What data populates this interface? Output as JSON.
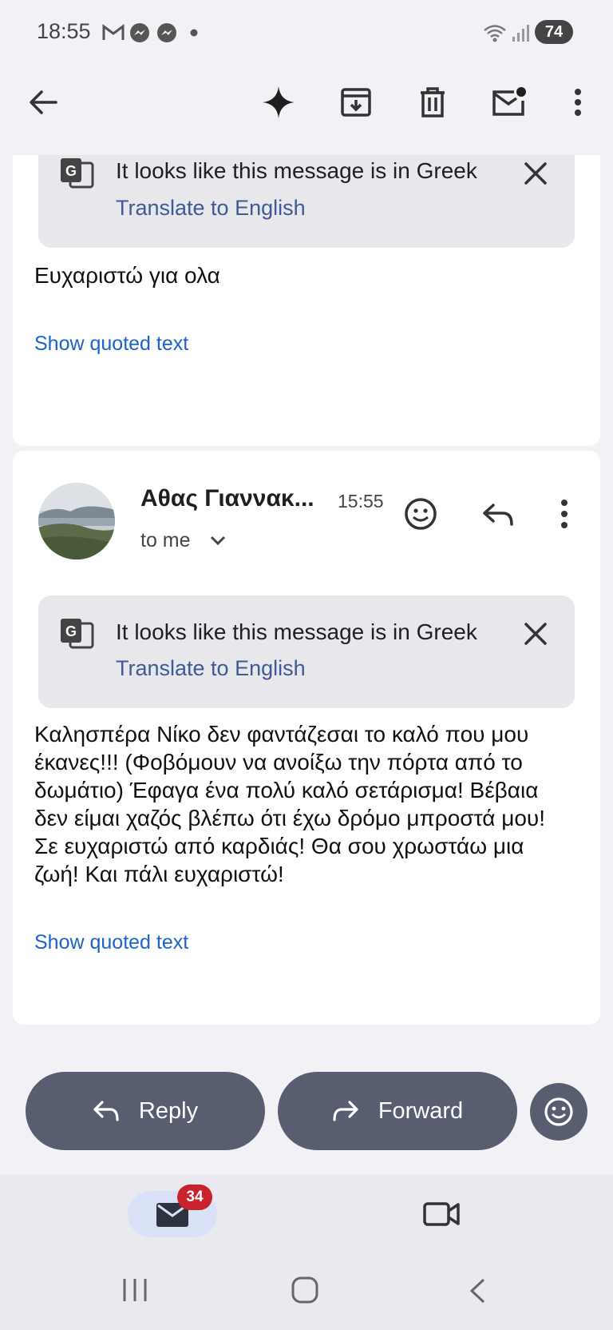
{
  "status_bar": {
    "time": "18:55",
    "battery": "74"
  },
  "toolbar": {
    "back": "back-arrow-icon",
    "icons": [
      "gemini-sparkle-icon",
      "archive-icon",
      "delete-icon",
      "mark-unread-icon",
      "more-vert-icon"
    ]
  },
  "message1": {
    "translate_banner": {
      "text": "It looks like this message is in Greek",
      "link": "Translate to English"
    },
    "body": "Ευχαριστώ για ολα",
    "show_quoted": "Show quoted text"
  },
  "message2": {
    "sender": "Αθας Γιαννακ...",
    "time": "15:55",
    "recipient": "to me",
    "translate_banner": {
      "text": "It looks like this message is in Greek",
      "link": "Translate to English"
    },
    "body_lines": [
      "Καλησπέρα Νίκο δεν φαντάζεσαι το καλό που μου",
      "έκανες!!! (Φοβόμουν να ανοίξω την πόρτα από το",
      "δωμάτιο) Έφαγα ένα πολύ καλό σετάρισμα! Βέβαια",
      "δεν είμαι χαζός βλέπω ότι έχω δρόμο μπροστά μου!",
      "Σε ευχαριστώ από καρδιάς! Θα σου χρωστάω μια",
      "ζωή! Και πάλι ευχαριστώ!"
    ],
    "show_quoted": "Show quoted text"
  },
  "actions": {
    "reply": "Reply",
    "forward": "Forward"
  },
  "bottom_nav": {
    "mail_badge": "34"
  },
  "colors": {
    "accent_link": "#1a63c8",
    "pill_bg": "#595d70",
    "badge": "#c8232c"
  }
}
